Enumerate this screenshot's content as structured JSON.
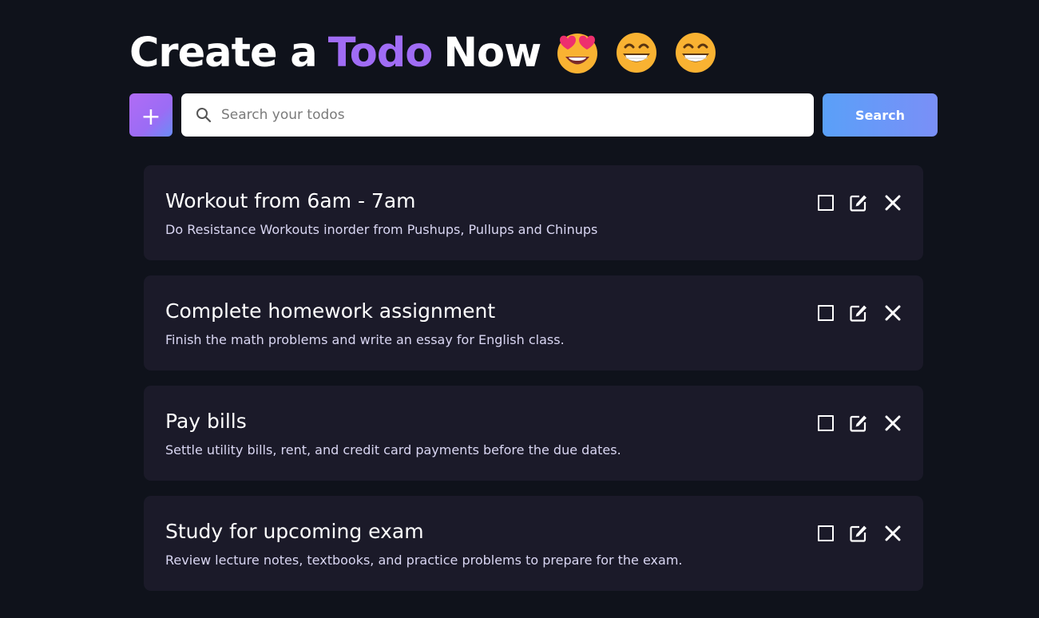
{
  "header": {
    "title_prefix": "Create a",
    "title_accent": "Todo",
    "title_suffix": "Now",
    "emojis": [
      "heart-eyes-emoji",
      "grinning-emoji",
      "grinning-emoji"
    ]
  },
  "toolbar": {
    "add_label": "+",
    "search_placeholder": "Search your todos",
    "search_value": "",
    "search_button_label": "Search"
  },
  "todos": [
    {
      "title": "Workout from 6am - 7am",
      "description": "Do Resistance Workouts inorder from Pushups, Pullups and Chinups",
      "completed": false
    },
    {
      "title": "Complete homework assignment",
      "description": "Finish the math problems and write an essay for English class.",
      "completed": false
    },
    {
      "title": "Pay bills",
      "description": "Settle utility bills, rent, and credit card payments before the due dates.",
      "completed": false
    },
    {
      "title": "Study for upcoming exam",
      "description": "Review lecture notes, textbooks, and practice problems to prepare for the exam.",
      "completed": false
    }
  ],
  "colors": {
    "background": "#0f121b",
    "card": "#1b1a29",
    "accent": "#a06cf5",
    "search_button": "#5aa0f8"
  }
}
